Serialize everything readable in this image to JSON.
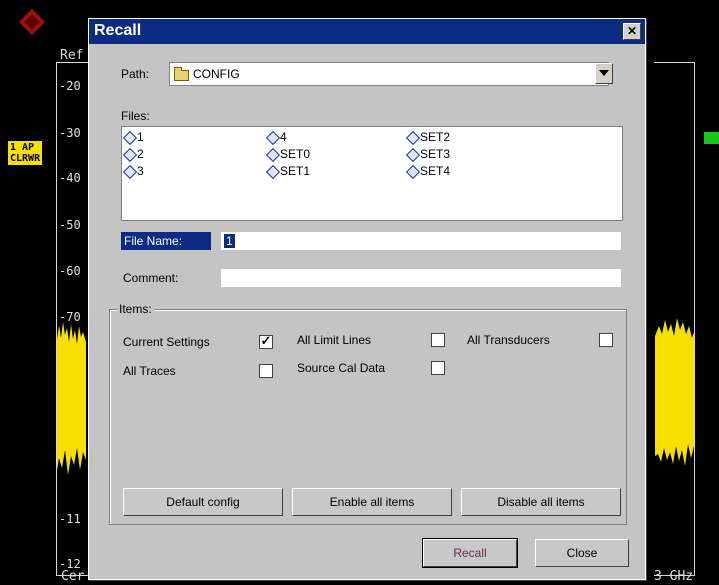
{
  "background": {
    "ref_label": "Ref",
    "scale_labels": [
      "-20",
      "-30",
      "-40",
      "-50",
      "-60",
      "-70",
      "-11",
      "-12"
    ],
    "trace_badge": "1 AP\nCLRWR",
    "center_label": "Cer",
    "freq_suffix": "3 GHz",
    "colors": {
      "trace": "#f6e000",
      "badge": "#f6e000",
      "green_tag": "#18c818"
    }
  },
  "dialog": {
    "title": "Recall",
    "close_glyph": "✕",
    "path_label": "Path:",
    "path_value": "CONFIG",
    "files_label": "Files:",
    "files": [
      [
        "1",
        "2",
        "3"
      ],
      [
        "4",
        "SET0",
        "SET1"
      ],
      [
        "SET2",
        "SET3",
        "SET4"
      ]
    ],
    "file_name_label": "File Name:",
    "file_name_value": "1",
    "comment_label": "Comment:",
    "comment_value": "",
    "items_label": "Items:",
    "items": {
      "current_settings": {
        "label": "Current Settings",
        "checked": true
      },
      "all_limit_lines": {
        "label": "All Limit Lines",
        "checked": false
      },
      "all_transducers": {
        "label": "All Transducers",
        "checked": false
      },
      "all_traces": {
        "label": "All Traces",
        "checked": false
      },
      "source_cal_data": {
        "label": "Source Cal Data",
        "checked": false
      }
    },
    "buttons": {
      "default_config": "Default config",
      "enable_all": "Enable all items",
      "disable_all": "Disable all items",
      "recall": "Recall",
      "close": "Close"
    },
    "colors": {
      "titlebar": "#0c2c84",
      "dialog_bg": "#c4c4c4"
    }
  }
}
